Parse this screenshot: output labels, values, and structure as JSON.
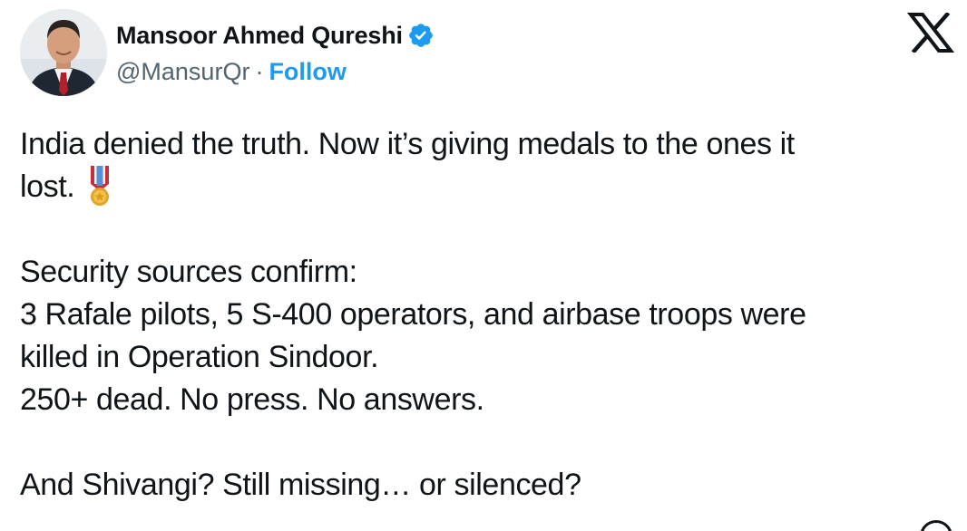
{
  "author": {
    "display_name": "Mansoor Ahmed Qureshi",
    "handle": "@MansurQr",
    "separator": "·",
    "follow_label": "Follow",
    "verified": true
  },
  "colors": {
    "accent": "#1d9bf0",
    "text": "#0f1419",
    "secondary": "#536471"
  },
  "icons": {
    "avatar": "profile-photo",
    "verified": "verified-badge-icon",
    "platform": "x-logo-icon",
    "medal": "military-medal-icon"
  },
  "tweet": {
    "lines": [
      "India denied the truth. Now it’s giving medals to the ones it",
      "lost.",
      "",
      "Security sources confirm:",
      "3 Rafale pilots, 5 S-400 operators, and airbase troops were",
      "killed in Operation Sindoor.",
      "250+ dead. No press. No answers.",
      "",
      "And Shivangi? Still missing… or silenced?"
    ]
  }
}
